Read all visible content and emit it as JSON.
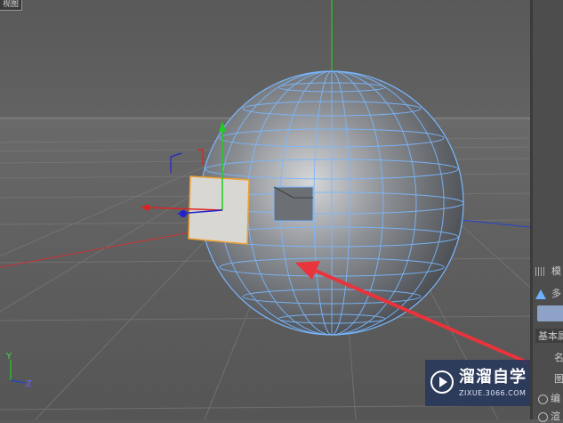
{
  "viewport": {
    "label": "视图",
    "axis_labels": {
      "y": "Y",
      "z": "Z"
    }
  },
  "panel": {
    "tab_label": "模",
    "object_label": "多",
    "section_label": "基本属",
    "row1": "名",
    "row2": "图",
    "row3": "编",
    "row4": "渲"
  },
  "watermark": {
    "title": "溜溜自学",
    "url": "ZIXUE.3066.COM"
  },
  "colors": {
    "wire": "#7ab8ff",
    "arrow": "#e8343a",
    "axis_x": "#d22",
    "axis_y": "#2c2",
    "axis_z": "#22c",
    "selection": "#f0a030"
  }
}
